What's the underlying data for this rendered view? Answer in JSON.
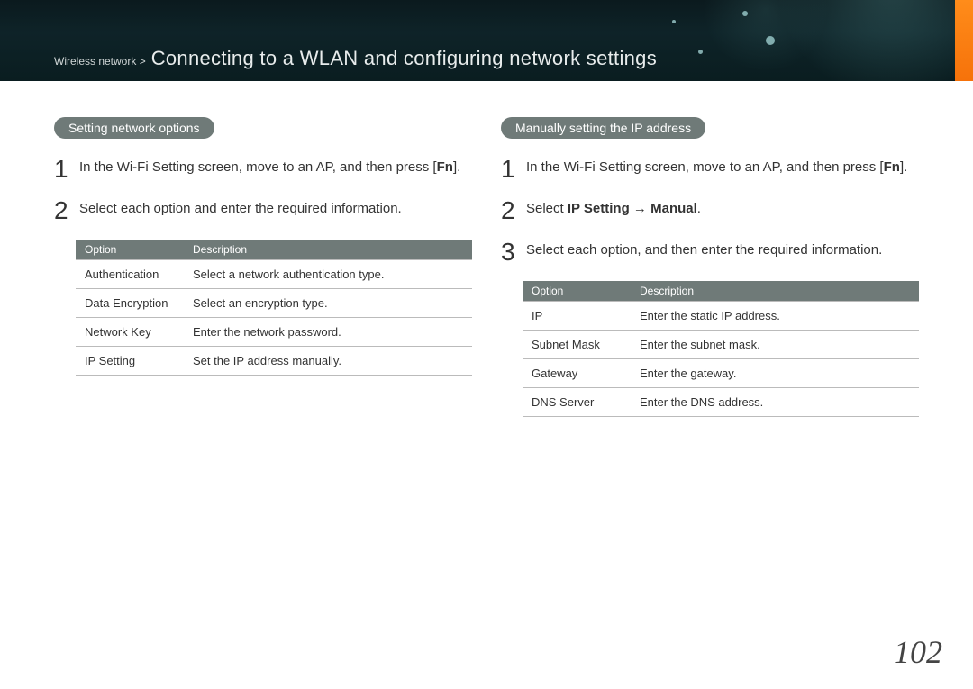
{
  "header": {
    "breadcrumb": "Wireless network >",
    "title": "Connecting to a WLAN and configuring network settings"
  },
  "left": {
    "pill": "Setting network options",
    "steps": [
      {
        "num": "1",
        "pre": "In the Wi-Fi Setting screen, move to an AP, and then press [",
        "fn": "Fn",
        "post": "]."
      },
      {
        "num": "2",
        "text": "Select each option and enter the required information."
      }
    ],
    "table": {
      "head": [
        "Option",
        "Description"
      ],
      "rows": [
        [
          "Authentication",
          "Select a network authentication type."
        ],
        [
          "Data Encryption",
          "Select an encryption type."
        ],
        [
          "Network Key",
          "Enter the network password."
        ],
        [
          "IP Setting",
          "Set the IP address manually."
        ]
      ]
    }
  },
  "right": {
    "pill": "Manually setting the IP address",
    "steps": [
      {
        "num": "1",
        "pre": "In the Wi-Fi Setting screen, move to an AP, and then press [",
        "fn": "Fn",
        "post": "]."
      },
      {
        "num": "2",
        "pre": "Select ",
        "bold1": "IP Setting",
        "arrow": " → ",
        "bold2": "Manual",
        "post2": "."
      },
      {
        "num": "3",
        "text": "Select each option, and then enter the required information."
      }
    ],
    "table": {
      "head": [
        "Option",
        "Description"
      ],
      "rows": [
        [
          "IP",
          "Enter the static IP address."
        ],
        [
          "Subnet Mask",
          "Enter the subnet mask."
        ],
        [
          "Gateway",
          "Enter the gateway."
        ],
        [
          "DNS Server",
          "Enter the DNS address."
        ]
      ]
    }
  },
  "page_number": "102"
}
